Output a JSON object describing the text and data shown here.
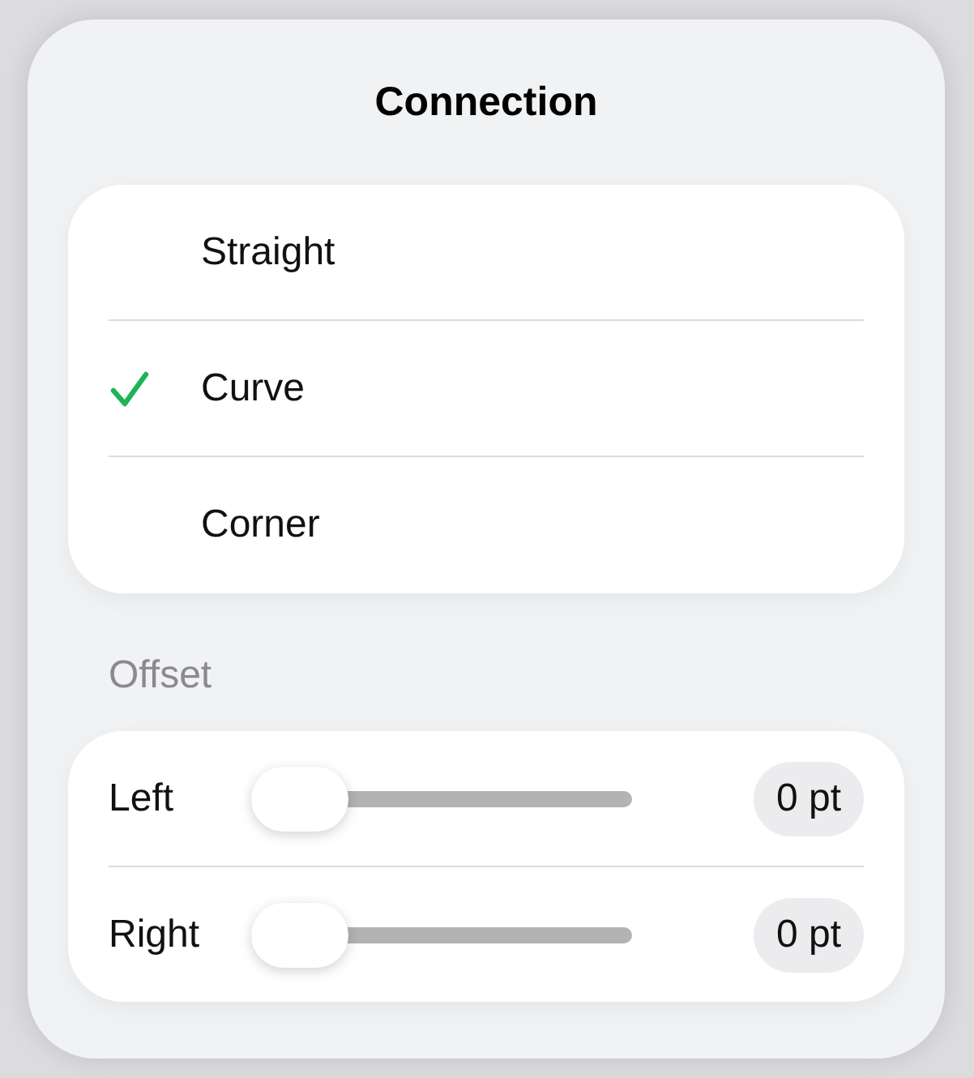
{
  "popover": {
    "title": "Connection"
  },
  "options": [
    {
      "label": "Straight",
      "selected": false
    },
    {
      "label": "Curve",
      "selected": true
    },
    {
      "label": "Corner",
      "selected": false
    }
  ],
  "offset": {
    "heading": "Offset",
    "sliders": [
      {
        "label": "Left",
        "level": 0,
        "reading": "0 pt"
      },
      {
        "label": "Right",
        "level": 0,
        "reading": "0 pt"
      }
    ]
  }
}
